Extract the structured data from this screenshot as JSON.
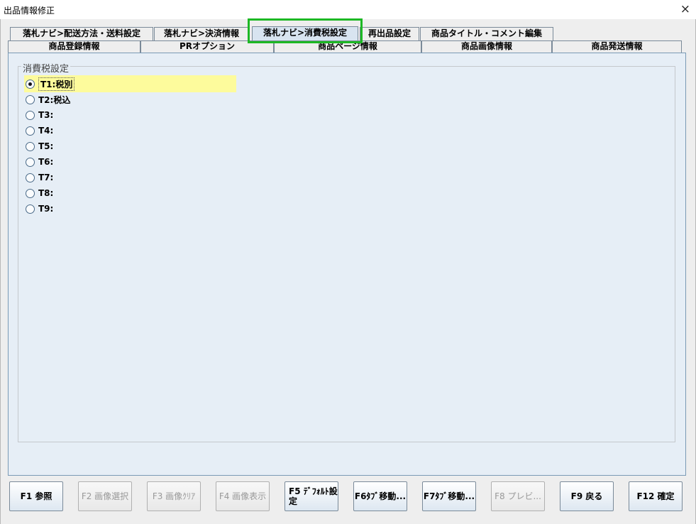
{
  "window": {
    "title": "出品情報修正",
    "close_label": "×"
  },
  "tabs_row1": [
    {
      "label": "落札ナビ>配送方法・送料設定"
    },
    {
      "label": "落札ナビ>決済情報"
    },
    {
      "label": "落札ナビ>消費税設定",
      "selected": true
    },
    {
      "label": "再出品設定"
    },
    {
      "label": "商品タイトル・コメント編集"
    }
  ],
  "tabs_row2": [
    {
      "label": "商品登録情報"
    },
    {
      "label": "PRオプション"
    },
    {
      "label": "商品ページ情報"
    },
    {
      "label": "商品画像情報"
    },
    {
      "label": "商品発送情報"
    }
  ],
  "group": {
    "title": "消費税設定",
    "options": [
      {
        "label": "T1:税別",
        "checked": true
      },
      {
        "label": "T2:税込",
        "checked": false
      },
      {
        "label": "T3:",
        "checked": false
      },
      {
        "label": "T4:",
        "checked": false
      },
      {
        "label": "T5:",
        "checked": false
      },
      {
        "label": "T6:",
        "checked": false
      },
      {
        "label": "T7:",
        "checked": false
      },
      {
        "label": "T8:",
        "checked": false
      },
      {
        "label": "T9:",
        "checked": false
      }
    ]
  },
  "footer_buttons": [
    {
      "label": "F1 参照",
      "enabled": true
    },
    {
      "label": "F2 画像選択",
      "enabled": false
    },
    {
      "label": "F3 画像ｸﾘｱ",
      "enabled": false
    },
    {
      "label": "F4 画像表示",
      "enabled": false
    },
    {
      "label": "F5 ﾃﾞﾌｫﾙﾄ設定",
      "enabled": true
    },
    {
      "label": "F6ﾀﾌﾞ移動...",
      "enabled": true
    },
    {
      "label": "F7ﾀﾌﾞ移動...",
      "enabled": true
    },
    {
      "label": "F8 プレビ...",
      "enabled": false
    },
    {
      "label": "F9 戻る",
      "enabled": true
    },
    {
      "label": "F12 確定",
      "enabled": true
    }
  ]
}
